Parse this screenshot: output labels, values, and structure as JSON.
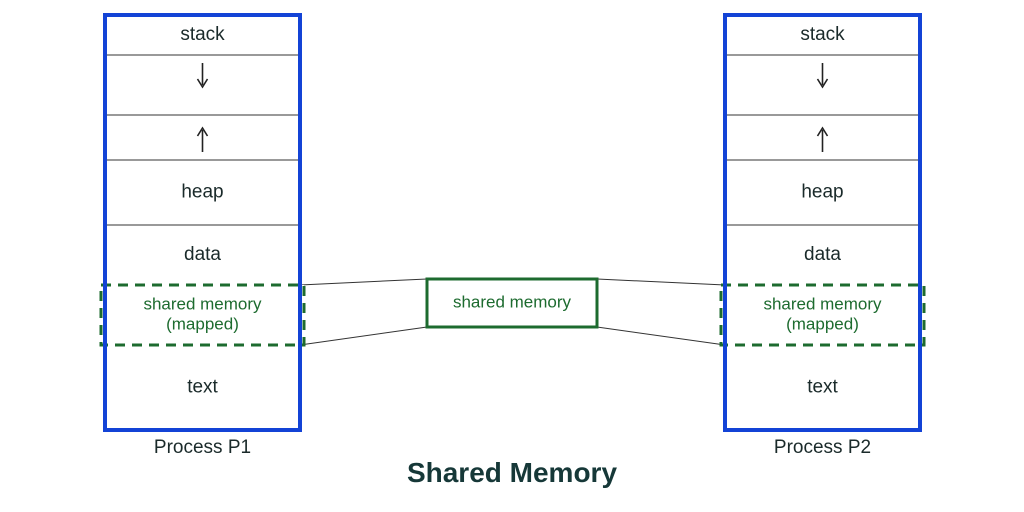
{
  "title": "Shared Memory",
  "center_block": {
    "label": "shared memory"
  },
  "processes": [
    {
      "title": "Process P1",
      "segments": {
        "stack": "stack",
        "heap": "heap",
        "data": "data",
        "shared_line1": "shared memory",
        "shared_line2": "(mapped)",
        "text": "text"
      }
    },
    {
      "title": "Process P2",
      "segments": {
        "stack": "stack",
        "heap": "heap",
        "data": "data",
        "shared_line1": "shared memory",
        "shared_line2": "(mapped)",
        "text": "text"
      }
    }
  ],
  "colors": {
    "process_border": "#1343d6",
    "segment_line": "#333333",
    "shared_green": "#1d6b2f",
    "arrow": "#222222"
  }
}
